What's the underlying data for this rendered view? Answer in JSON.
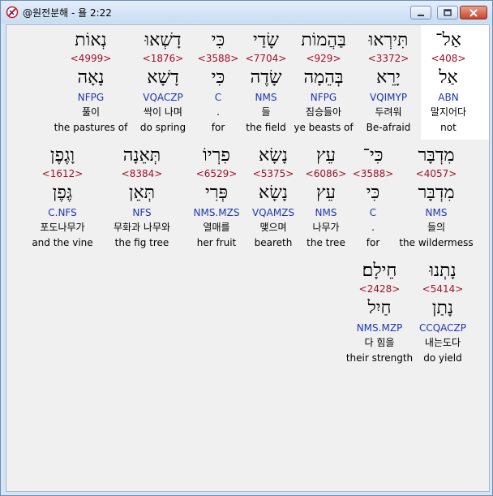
{
  "window": {
    "title": "@원전분해 - 욜 2:22"
  },
  "rows": [
    [
      {
        "hebrew": "אַל־",
        "strong": "<408>",
        "lemma": "אַל",
        "morph": "ABN",
        "korean": "말지어다",
        "english": "not",
        "highlight": true
      },
      {
        "hebrew": "תִּירְאוּ",
        "strong": "<3372>",
        "lemma": "יָרֵא",
        "morph": "VQIMYP",
        "korean": "두려워",
        "english": "Be-afraid"
      },
      {
        "hebrew": "בַּהֲמוֹת",
        "strong": "<929>",
        "lemma": "בְּהֵמָה",
        "morph": "NFPG",
        "korean": "짐승들아",
        "english": "ye beasts of"
      },
      {
        "hebrew": "שָׂדַי",
        "strong": "<7704>",
        "lemma": "שָׂדֶה",
        "morph": "NMS",
        "korean": "들",
        "english": "the field"
      },
      {
        "hebrew": "כִּי",
        "strong": "<3588>",
        "lemma": "כִּי",
        "morph": "C",
        "korean": ".",
        "english": "for"
      },
      {
        "hebrew": "דָשְׁאוּ",
        "strong": "<1876>",
        "lemma": "דָשָׁא",
        "morph": "VQACZP",
        "korean": "싹이 나며",
        "english": "do spring"
      },
      {
        "hebrew": "נְאוֹת",
        "strong": "<4999>",
        "lemma": "נָאָה",
        "morph": "NFPG",
        "korean": "풀이",
        "english": "the pastures of"
      }
    ],
    [
      {
        "hebrew": "מִדְבָּר",
        "strong": "<4057>",
        "lemma": "מִדְבָּר",
        "morph": "NMS",
        "korean": "들의",
        "english": "the wildermess"
      },
      {
        "hebrew": "כִּי־",
        "strong": "<3588>",
        "lemma": "כִּי",
        "morph": "C",
        "korean": ".",
        "english": "for"
      },
      {
        "hebrew": "עֵץ",
        "strong": "<6086>",
        "lemma": "עֵץ",
        "morph": "NMS",
        "korean": "나무가",
        "english": "the tree"
      },
      {
        "hebrew": "נָשָׂא",
        "strong": "<5375>",
        "lemma": "נָשָׂא",
        "morph": "VQAMZS",
        "korean": "맺으며",
        "english": "beareth"
      },
      {
        "hebrew": "פִרְיוֹ",
        "strong": "<6529>",
        "lemma": "פְּרִי",
        "morph": "NMS.MZS",
        "korean": "열매를",
        "english": "her fruit"
      },
      {
        "hebrew": "תְּאֵנָה",
        "strong": "<8384>",
        "lemma": "תְּאֵן",
        "morph": "NFS",
        "korean": "무화과 나무와",
        "english": "the fig tree"
      },
      {
        "hebrew": "וָגֶפֶן",
        "strong": "<1612>",
        "lemma": "גֶּפֶן",
        "morph": "C.NFS",
        "korean": "포도나무가",
        "english": "and the vine"
      }
    ],
    [
      {
        "hebrew": "נָתְנוּ",
        "strong": "<5414>",
        "lemma": "נָתַן",
        "morph": "CCQACZP",
        "korean": "내는도다",
        "english": "do yield"
      },
      {
        "hebrew": "חֵילָם׃",
        "strong": "<2428>",
        "lemma": "חַיִל",
        "morph": "NMS.MZP",
        "korean": "다 힘을",
        "english": "their strength"
      }
    ]
  ]
}
